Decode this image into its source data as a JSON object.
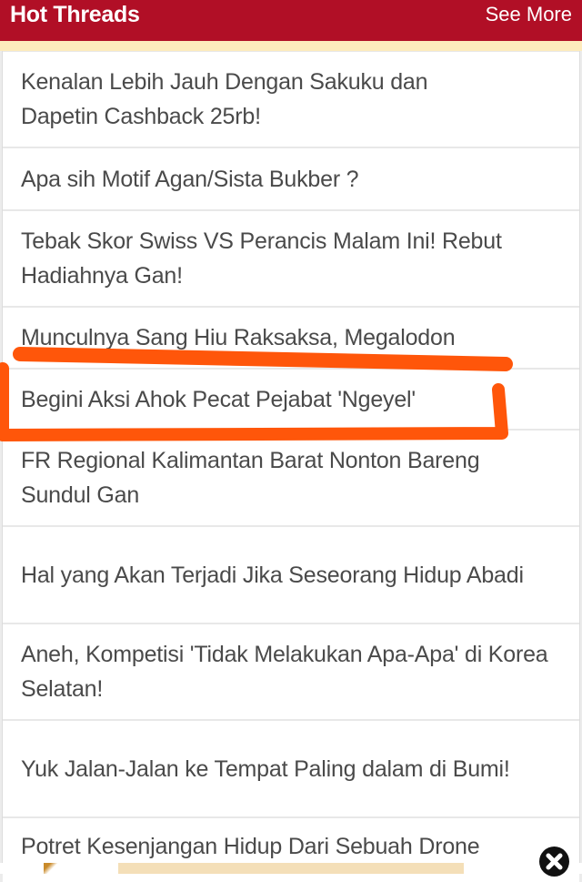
{
  "header": {
    "title": "Hot Threads",
    "see_more_label": "See More",
    "brand_color": "#b10f26"
  },
  "threads": [
    {
      "title": "Kenalan Lebih Jauh Dengan Sakuku dan Dapetin Cashback 25rb!"
    },
    {
      "title": "Apa sih Motif Agan/Sista Bukber ?"
    },
    {
      "title": "Tebak Skor Swiss VS Perancis Malam Ini! Rebut Hadiahnya Gan!"
    },
    {
      "title": "Munculnya Sang Hiu Raksaksa, Megalodon"
    },
    {
      "title": "Begini Aksi Ahok Pecat Pejabat 'Ngeyel'"
    },
    {
      "title": "FR Regional Kalimantan Barat Nonton Bareng Sundul Gan"
    },
    {
      "title": "Hal yang Akan Terjadi Jika Seseorang Hidup Abadi"
    },
    {
      "title": "Aneh, Kompetisi 'Tidak Melakukan Apa-Apa' di Korea Selatan!"
    },
    {
      "title": "Yuk Jalan-Jalan ke Tempat Paling dalam di Bumi!"
    },
    {
      "title": "Potret Kesenjangan Hidup Dari Sebuah Drone"
    }
  ],
  "annotation": {
    "description": "hand-drawn highlight around thread",
    "highlighted_thread": "Begini Aksi Ahok Pecat Pejabat 'Ngeyel'",
    "color": "#ff560a"
  },
  "ad_banner": {
    "close_icon": "close-x-icon"
  }
}
